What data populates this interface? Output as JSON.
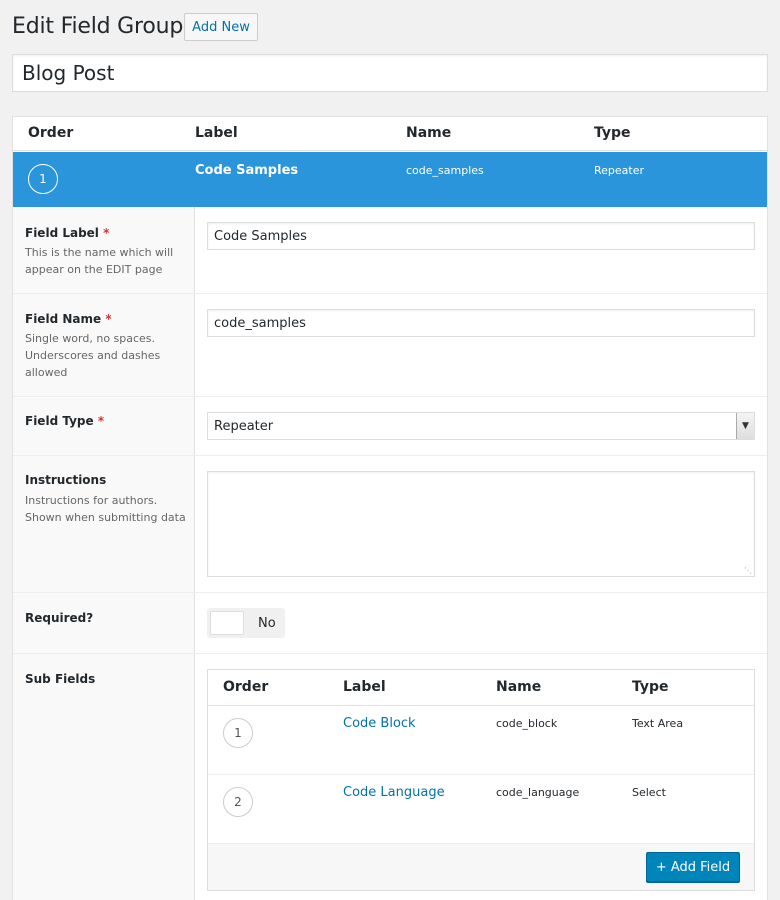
{
  "header": {
    "title": "Edit Field Group",
    "add_new_label": "Add New"
  },
  "group_title": "Blog Post",
  "table": {
    "columns": {
      "order": "Order",
      "label": "Label",
      "name": "Name",
      "type": "Type"
    },
    "active_field": {
      "order": "1",
      "label": "Code Samples",
      "name": "code_samples",
      "type": "Repeater"
    }
  },
  "settings": {
    "field_label": {
      "label": "Field Label",
      "required_mark": "*",
      "desc": "This is the name which will appear on the EDIT page",
      "value": "Code Samples"
    },
    "field_name": {
      "label": "Field Name",
      "required_mark": "*",
      "desc": "Single word, no spaces. Underscores and dashes allowed",
      "value": "code_samples"
    },
    "field_type": {
      "label": "Field Type",
      "required_mark": "*",
      "value": "Repeater"
    },
    "instructions": {
      "label": "Instructions",
      "desc": "Instructions for authors. Shown when submitting data",
      "value": ""
    },
    "required": {
      "label": "Required?",
      "toggle_text": "No"
    },
    "sub_fields": {
      "label": "Sub Fields",
      "columns": {
        "order": "Order",
        "label": "Label",
        "name": "Name",
        "type": "Type"
      },
      "rows": [
        {
          "order": "1",
          "label": "Code Block",
          "name": "code_block",
          "type": "Text Area"
        },
        {
          "order": "2",
          "label": "Code Language",
          "name": "code_language",
          "type": "Select"
        }
      ],
      "add_field_label": "+ Add Field"
    }
  },
  "colors": {
    "active_row": "#2a95db",
    "link": "#0073aa",
    "primary_button": "#0085ba",
    "required": "#dc3232"
  }
}
